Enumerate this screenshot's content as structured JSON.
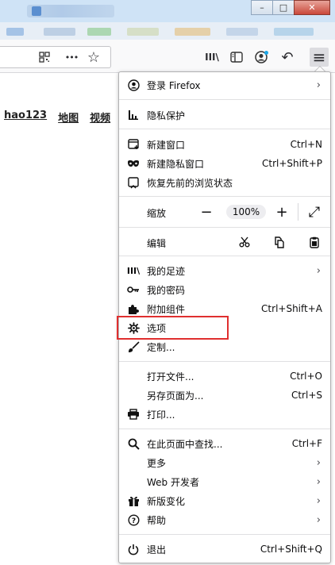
{
  "window": {
    "min_label": "–",
    "max_label": "□",
    "close_label": "✕"
  },
  "toolbar": {
    "icons": [
      "qr-code-icon",
      "more-icon",
      "star-icon",
      "library-icon",
      "sidebar-icon",
      "account-icon",
      "back-icon",
      "menu-icon"
    ],
    "more_label": "•••",
    "star_label": "☆",
    "library_label": "III\\",
    "back_label": "↶",
    "menu_label": "≡"
  },
  "page": {
    "links": [
      "hao123",
      "地图",
      "视频"
    ]
  },
  "menu": {
    "sign_in": "登录 Firefox",
    "privacy": "隐私保护",
    "new_window": {
      "label": "新建窗口",
      "shortcut": "Ctrl+N"
    },
    "new_private": {
      "label": "新建隐私窗口",
      "shortcut": "Ctrl+Shift+P"
    },
    "restore": "恢复先前的浏览状态",
    "zoom": {
      "label": "缩放",
      "minus": "−",
      "value": "100%",
      "plus": "+",
      "fullscreen": "⤢"
    },
    "edit": {
      "label": "编辑"
    },
    "library": "我的足迹",
    "passwords": "我的密码",
    "addons": {
      "label": "附加组件",
      "shortcut": "Ctrl+Shift+A"
    },
    "options": "选项",
    "customize": "定制...",
    "open_file": {
      "label": "打开文件...",
      "shortcut": "Ctrl+O"
    },
    "save_page": {
      "label": "另存页面为...",
      "shortcut": "Ctrl+S"
    },
    "print": "打印...",
    "find": {
      "label": "在此页面中查找...",
      "shortcut": "Ctrl+F"
    },
    "more": "更多",
    "web_dev": "Web 开发者",
    "whats_new": "新版变化",
    "help": "帮助",
    "exit": {
      "label": "退出",
      "shortcut": "Ctrl+Shift+Q"
    },
    "chevron": "›"
  },
  "colors": {
    "highlight": "#e02f2f",
    "panel_border": "#b1b1b3"
  }
}
